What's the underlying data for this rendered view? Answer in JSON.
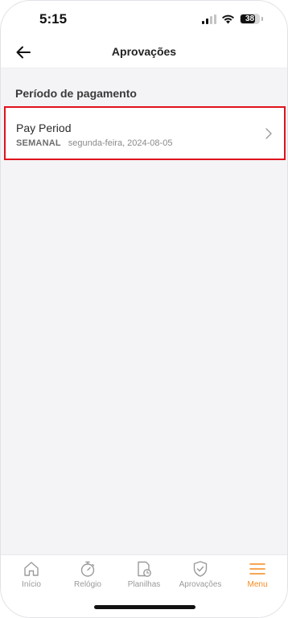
{
  "status_bar": {
    "time": "5:15",
    "battery": "38"
  },
  "header": {
    "title": "Aprovações"
  },
  "section": {
    "title": "Período de pagamento"
  },
  "pay_period": {
    "name": "Pay Period",
    "type": "SEMANAL",
    "date": "segunda-feira, 2024-08-05"
  },
  "tabs": [
    {
      "label": "Início",
      "icon": "home-icon"
    },
    {
      "label": "Relógio",
      "icon": "stopwatch-icon"
    },
    {
      "label": "Planilhas",
      "icon": "timesheet-icon"
    },
    {
      "label": "Aprovações",
      "icon": "shield-check-icon"
    },
    {
      "label": "Menu",
      "icon": "menu-icon",
      "active": true
    }
  ],
  "colors": {
    "accent": "#f5891f",
    "highlight": "#e0121d",
    "background": "#f4f4f7"
  }
}
